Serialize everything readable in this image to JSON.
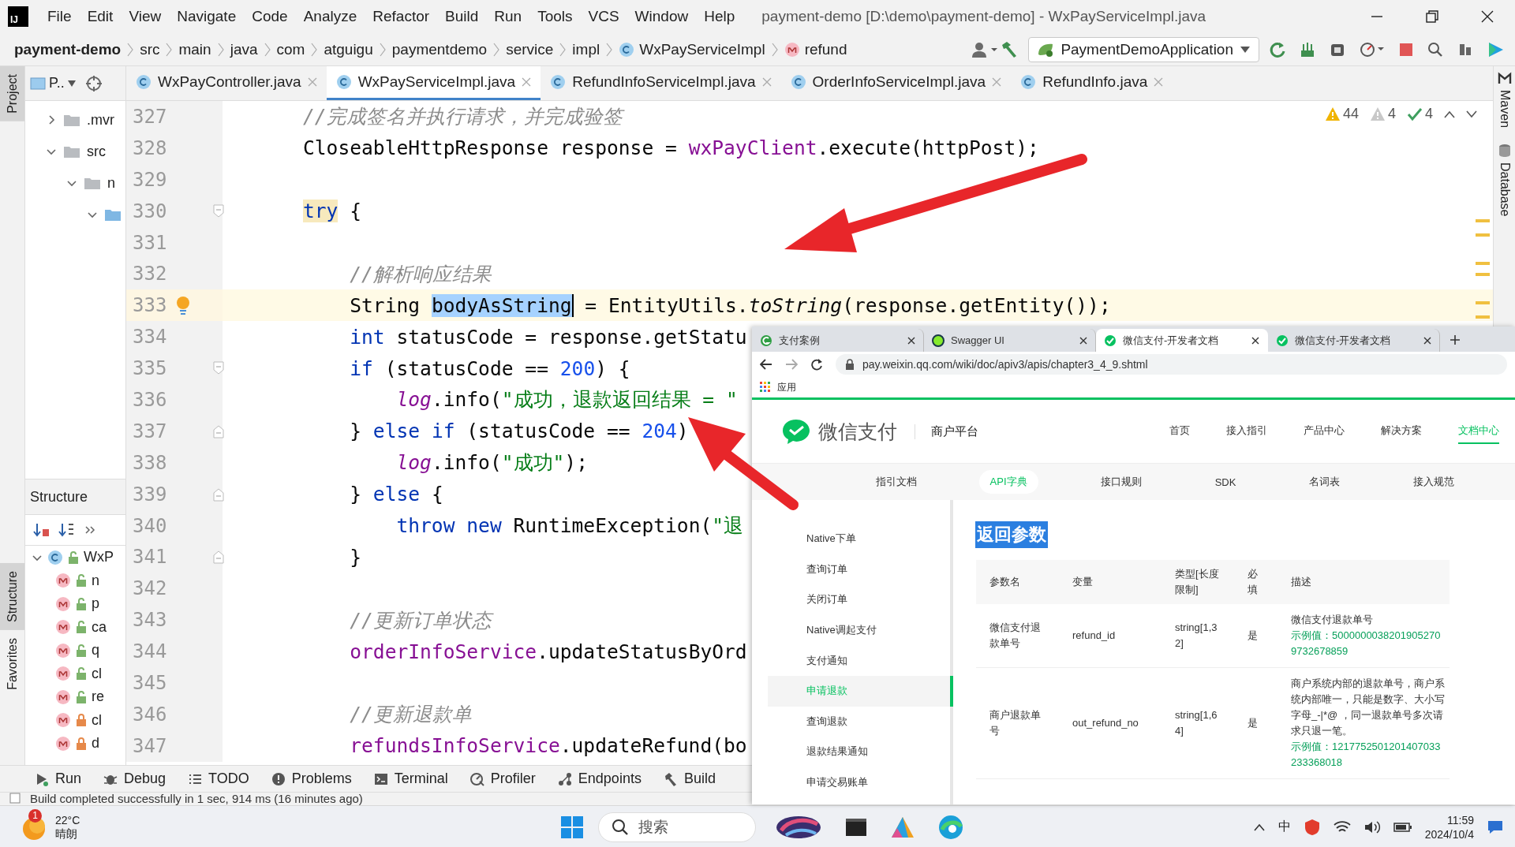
{
  "titlebar": {
    "logo_text": "IJ",
    "menu": [
      "File",
      "Edit",
      "View",
      "Navigate",
      "Code",
      "Analyze",
      "Refactor",
      "Build",
      "Run",
      "Tools",
      "VCS",
      "Window",
      "Help"
    ],
    "title": "payment-demo [D:\\demo\\payment-demo] - WxPayServiceImpl.java"
  },
  "toolbar": {
    "breadcrumbs": [
      {
        "text": "payment-demo",
        "kind": "project"
      },
      {
        "text": "src",
        "kind": "folder"
      },
      {
        "text": "main",
        "kind": "folder"
      },
      {
        "text": "java",
        "kind": "folder"
      },
      {
        "text": "com",
        "kind": "folder"
      },
      {
        "text": "atguigu",
        "kind": "folder"
      },
      {
        "text": "paymentdemo",
        "kind": "folder"
      },
      {
        "text": "service",
        "kind": "folder"
      },
      {
        "text": "impl",
        "kind": "folder"
      },
      {
        "text": "WxPayServiceImpl",
        "kind": "class"
      },
      {
        "text": "refund",
        "kind": "method"
      }
    ],
    "run_config": "PaymentDemoApplication"
  },
  "project_panel": {
    "label": "P..",
    "tree": [
      {
        "text": ".mvr",
        "expanded": false
      },
      {
        "text": "src",
        "expanded": true,
        "children": [
          {
            "text": "n",
            "expanded": true,
            "children": [
              {
                "kind": "source-folder",
                "expanded": true
              }
            ]
          }
        ]
      }
    ]
  },
  "structure_panel": {
    "title": "Structure",
    "root": {
      "text": "WxP",
      "expanded": true
    },
    "members": [
      {
        "text": "n",
        "kind": "public"
      },
      {
        "text": "p",
        "kind": "public"
      },
      {
        "text": "ca",
        "kind": "public"
      },
      {
        "text": "q",
        "kind": "public"
      },
      {
        "text": "cl",
        "kind": "public"
      },
      {
        "text": "re",
        "kind": "public"
      },
      {
        "text": "cl",
        "kind": "private"
      },
      {
        "text": "d",
        "kind": "private"
      }
    ]
  },
  "side_stripe": [
    {
      "label": "Project",
      "selected": true
    },
    {
      "label": "Structure",
      "selected": true
    },
    {
      "label": "Favorites",
      "selected": false
    }
  ],
  "right_stripe": [
    {
      "label": "Maven",
      "kind": "maven"
    },
    {
      "label": "Database",
      "kind": "database"
    }
  ],
  "editor_tabs": [
    {
      "label": "WxPayController.java",
      "selected": false
    },
    {
      "label": "WxPayServiceImpl.java",
      "selected": true
    },
    {
      "label": "RefundInfoServiceImpl.java",
      "selected": false
    },
    {
      "label": "OrderInfoServiceImpl.java",
      "selected": false
    },
    {
      "label": "RefundInfo.java",
      "selected": false
    }
  ],
  "inspections": [
    {
      "kind": "warning",
      "count": "44"
    },
    {
      "kind": "weak-warning",
      "count": "4"
    },
    {
      "kind": "typo",
      "count": "4"
    }
  ],
  "code": [
    {
      "number": "327",
      "kind": "plain",
      "tokens": [
        {
          "text": "//完成签名并执行请求，并完成验签",
          "kind": "comment"
        }
      ]
    },
    {
      "number": "328",
      "kind": "plain",
      "tokens": [
        {
          "text": "CloseableHttpResponse response = ",
          "kind": "plain"
        },
        {
          "text": "wxPayClient",
          "kind": "field"
        },
        {
          "text": ".execute(httpPost);",
          "kind": "plain"
        }
      ]
    },
    {
      "number": "329",
      "kind": "plain"
    },
    {
      "number": "330",
      "kind": "fold-start",
      "tokens": [
        {
          "text": "try",
          "kind": "keyword-match"
        },
        {
          "text": " {",
          "kind": "plain"
        }
      ]
    },
    {
      "number": "331",
      "kind": "plain"
    },
    {
      "number": "332",
      "kind": "plain",
      "tokens": [
        {
          "text": "    //解析响应结果",
          "kind": "comment"
        }
      ]
    },
    {
      "number": "333",
      "kind": "plain",
      "current": true,
      "bulb": true,
      "tokens": [
        {
          "text": "    String ",
          "kind": "plain"
        },
        {
          "text": "bodyAsString",
          "kind": "selected"
        },
        {
          "text": " = EntityUtils.",
          "kind": "plain"
        },
        {
          "text": "toString",
          "kind": "static-method"
        },
        {
          "text": "(response.getEntity());",
          "kind": "plain"
        }
      ]
    },
    {
      "number": "334",
      "kind": "plain",
      "tokens": [
        {
          "text": "    int",
          "kind": "keyword"
        },
        {
          "text": " statusCode = response.getStatu",
          "kind": "plain"
        }
      ]
    },
    {
      "number": "335",
      "kind": "fold-start",
      "tokens": [
        {
          "text": "    if",
          "kind": "keyword"
        },
        {
          "text": " (statusCode == ",
          "kind": "plain"
        },
        {
          "text": "200",
          "kind": "number"
        },
        {
          "text": ") {",
          "kind": "plain"
        }
      ]
    },
    {
      "number": "336",
      "kind": "plain",
      "tokens": [
        {
          "text": "        log",
          "kind": "static-field"
        },
        {
          "text": ".info(",
          "kind": "plain"
        },
        {
          "text": "\"成功，退款返回结果 = \"",
          "kind": "string"
        }
      ]
    },
    {
      "number": "337",
      "kind": "fold-end",
      "tokens": [
        {
          "text": "    } ",
          "kind": "plain"
        },
        {
          "text": "else if",
          "kind": "keyword"
        },
        {
          "text": " (statusCode == ",
          "kind": "plain"
        },
        {
          "text": "204",
          "kind": "number"
        },
        {
          "text": ")",
          "kind": "plain"
        }
      ]
    },
    {
      "number": "338",
      "kind": "plain",
      "tokens": [
        {
          "text": "        log",
          "kind": "static-field"
        },
        {
          "text": ".info(",
          "kind": "plain"
        },
        {
          "text": "\"成功\"",
          "kind": "string"
        },
        {
          "text": ");",
          "kind": "plain"
        }
      ]
    },
    {
      "number": "339",
      "kind": "fold-end",
      "tokens": [
        {
          "text": "    } ",
          "kind": "plain"
        },
        {
          "text": "else",
          "kind": "keyword"
        },
        {
          "text": " {",
          "kind": "plain"
        }
      ]
    },
    {
      "number": "340",
      "kind": "plain",
      "tokens": [
        {
          "text": "        throw new",
          "kind": "keyword"
        },
        {
          "text": " RuntimeException(",
          "kind": "plain"
        },
        {
          "text": "\"退",
          "kind": "string"
        }
      ]
    },
    {
      "number": "341",
      "kind": "fold-end",
      "tokens": [
        {
          "text": "    }",
          "kind": "plain"
        }
      ]
    },
    {
      "number": "342",
      "kind": "plain"
    },
    {
      "number": "343",
      "kind": "plain",
      "tokens": [
        {
          "text": "    //更新订单状态",
          "kind": "comment"
        }
      ]
    },
    {
      "number": "344",
      "kind": "plain",
      "tokens": [
        {
          "text": "    orderInfoService",
          "kind": "field"
        },
        {
          "text": ".updateStatusByOrd",
          "kind": "plain"
        }
      ]
    },
    {
      "number": "345",
      "kind": "plain"
    },
    {
      "number": "346",
      "kind": "plain",
      "tokens": [
        {
          "text": "    //更新退款单",
          "kind": "comment"
        }
      ]
    },
    {
      "number": "347",
      "kind": "plain",
      "tokens": [
        {
          "text": "    refundsInfoService",
          "kind": "field"
        },
        {
          "text": ".updateRefund(bo",
          "kind": "plain"
        }
      ]
    }
  ],
  "tool_tabs": [
    {
      "label": "Run",
      "kind": "run"
    },
    {
      "label": "Debug",
      "kind": "debug"
    },
    {
      "label": "TODO",
      "kind": "todo"
    },
    {
      "label": "Problems",
      "kind": "problems"
    },
    {
      "label": "Terminal",
      "kind": "terminal"
    },
    {
      "label": "Profiler",
      "kind": "profiler"
    },
    {
      "label": "Endpoints",
      "kind": "endpoints"
    },
    {
      "label": "Build",
      "kind": "build"
    }
  ],
  "status_bar": "Build completed successfully in 1 sec, 914 ms (16 minutes ago)",
  "browser": {
    "tabs": [
      {
        "title": "支付案例",
        "kind": "case",
        "selected": false
      },
      {
        "title": "Swagger UI",
        "kind": "swagger",
        "selected": false
      },
      {
        "title": "微信支付-开发者文档",
        "kind": "wechat",
        "selected": true
      },
      {
        "title": "微信支付-开发者文档",
        "kind": "wechat",
        "selected": false
      }
    ],
    "url": "pay.weixin.qq.com/wiki/doc/apiv3/apis/chapter3_4_9.shtml",
    "bookmarks": [
      "应用"
    ],
    "site": {
      "brand": "微信支付",
      "platform": "商户平台",
      "nav": [
        {
          "label": "首页",
          "selected": false
        },
        {
          "label": "接入指引",
          "selected": false
        },
        {
          "label": "产品中心",
          "selected": false
        },
        {
          "label": "解决方案",
          "selected": false
        },
        {
          "label": "文档中心",
          "selected": true
        }
      ],
      "subnav": [
        {
          "label": "指引文档",
          "selected": false
        },
        {
          "label": "API字典",
          "selected": true
        },
        {
          "label": "接口规则",
          "selected": false
        },
        {
          "label": "SDK",
          "selected": false
        },
        {
          "label": "名词表",
          "selected": false
        },
        {
          "label": "接入规范",
          "selected": false
        }
      ],
      "menu": [
        {
          "label": "Native下单",
          "selected": false
        },
        {
          "label": "查询订单",
          "selected": false
        },
        {
          "label": "关闭订单",
          "selected": false
        },
        {
          "label": "Native调起支付",
          "selected": false
        },
        {
          "label": "支付通知",
          "selected": false
        },
        {
          "label": "申请退款",
          "selected": true
        },
        {
          "label": "查询退款",
          "selected": false
        },
        {
          "label": "退款结果通知",
          "selected": false
        },
        {
          "label": "申请交易账单",
          "selected": false
        }
      ],
      "heading": "返回参数",
      "table": {
        "columns": [
          "参数名",
          "变量",
          "类型[长度限制]",
          "必填",
          "描述"
        ],
        "rows": [
          {
            "name": "微信支付退款单号",
            "variable": "refund_id",
            "type": "string[1,32]",
            "required": "是",
            "description": "微信支付退款单号",
            "example": "示例值：50000000382019052709732678859"
          },
          {
            "name": "商户退款单号",
            "variable": "out_refund_no",
            "type": "string[1,64]",
            "required": "是",
            "description": "商户系统内部的退款单号，商户系统内部唯一，只能是数字、大小写字母_-|*@ ，同一退款单号多次请求只退一笔。",
            "example": "示例值：1217752501201407033233368018"
          }
        ]
      }
    }
  },
  "taskbar": {
    "weather": {
      "badge": "1",
      "temperature": "22°C",
      "condition": "晴朗"
    },
    "search": {
      "placeholder": "搜索"
    },
    "tray": {
      "ime": "中"
    },
    "clock": {
      "time": "11:59",
      "date": "2024/10/4"
    }
  }
}
